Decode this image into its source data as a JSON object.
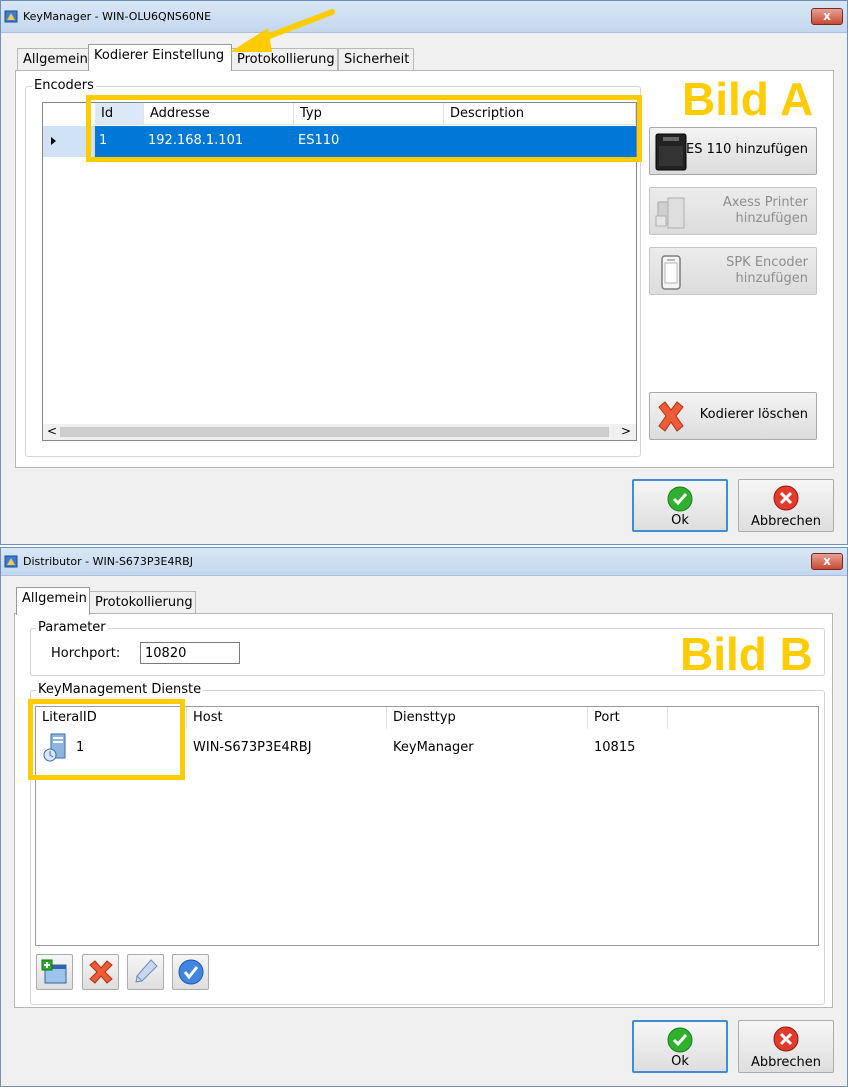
{
  "window_a": {
    "title": "KeyManager - WIN-OLU6QNS60NE",
    "close_label": "x",
    "tabs": [
      {
        "label": "Allgemein"
      },
      {
        "label": "Kodierer Einstellung"
      },
      {
        "label": "Protokollierung"
      },
      {
        "label": "Sicherheit"
      }
    ],
    "group_title": "Encoders",
    "columns": [
      "Id",
      "Addresse",
      "Typ",
      "Description"
    ],
    "rows": [
      {
        "id": "1",
        "address": "192.168.1.101",
        "type": "ES110",
        "description": ""
      }
    ],
    "buttons": {
      "add_es110": "ES 110 hinzufügen",
      "add_axess_line1": "Axess Printer",
      "add_axess_line2": "hinzufügen",
      "add_spk_line1": "SPK Encoder",
      "add_spk_line2": "hinzufügen",
      "delete_encoder": "Kodierer löschen",
      "ok": "Ok",
      "cancel": "Abbrechen"
    },
    "scroll_left": "<",
    "scroll_right": ">",
    "annotation": "Bild A"
  },
  "window_b": {
    "title": "Distributor - WIN-S673P3E4RBJ",
    "close_label": "x",
    "tabs": [
      {
        "label": "Allgemein"
      },
      {
        "label": "Protokollierung"
      }
    ],
    "parameter_group": "Parameter",
    "listen_port_label": "Horchport:",
    "listen_port_value": "10820",
    "services_group": "KeyManagement Dienste",
    "columns": [
      "LiteralID",
      "Host",
      "Diensttyp",
      "Port"
    ],
    "rows": [
      {
        "literal_id": "1",
        "host": "WIN-S673P3E4RBJ",
        "service_type": "KeyManager",
        "port": "10815"
      }
    ],
    "buttons": {
      "ok": "Ok",
      "cancel": "Abbrechen"
    },
    "annotation": "Bild B"
  },
  "colors": {
    "selection": "#0078d7",
    "highlight": "#ffcc00",
    "default_button_border": "#3c8fd6"
  }
}
